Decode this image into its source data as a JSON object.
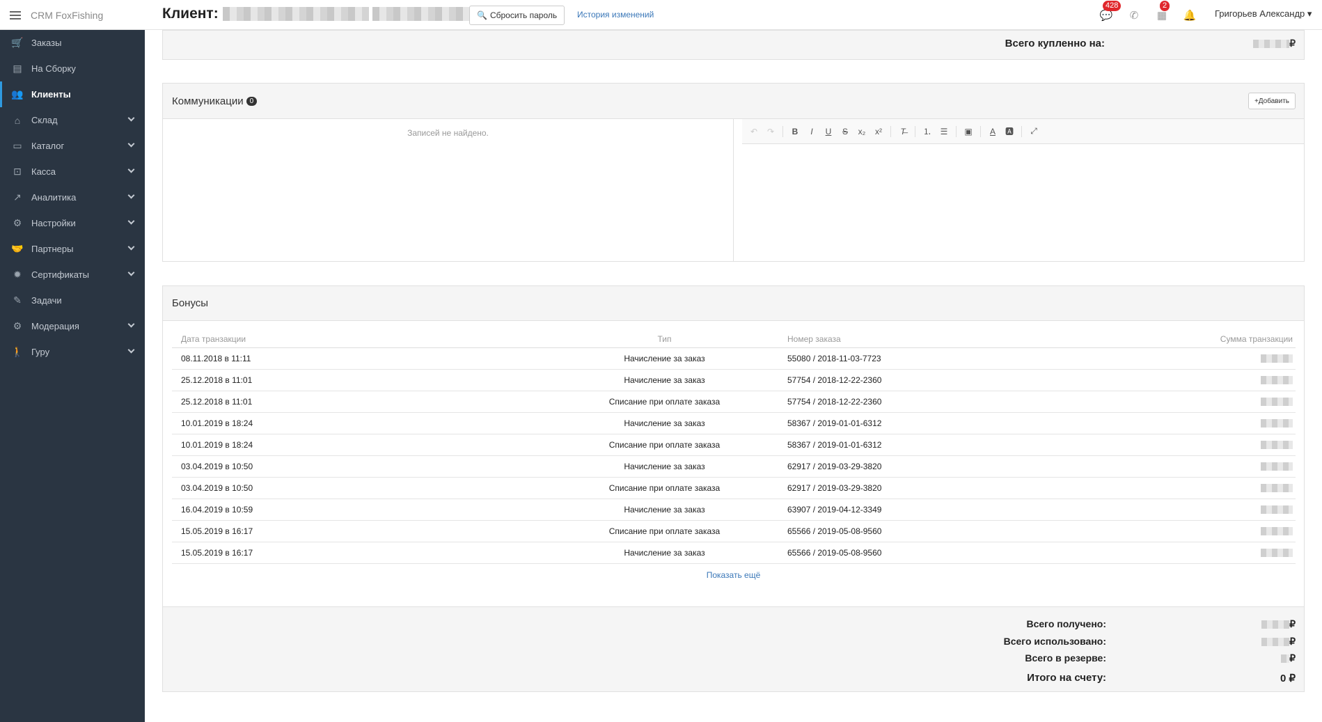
{
  "app": {
    "brand": "CRM FoxFishing"
  },
  "header": {
    "title": "Клиент:",
    "reset_password_label": "Сбросить пароль",
    "history_link": "История изменений",
    "messages_badge": "428",
    "tasks_badge": "2",
    "user_name": "Григорьев Александр"
  },
  "sidebar": {
    "items": [
      {
        "label": "Заказы",
        "icon": "cart-icon",
        "glyph": "🛒",
        "has_submenu": false,
        "active": false
      },
      {
        "label": "На Сборку",
        "icon": "box-icon",
        "glyph": "▤",
        "has_submenu": false,
        "active": false
      },
      {
        "label": "Клиенты",
        "icon": "users-icon",
        "glyph": "👥",
        "has_submenu": false,
        "active": true
      },
      {
        "label": "Склад",
        "icon": "home-icon",
        "glyph": "⌂",
        "has_submenu": true,
        "active": false
      },
      {
        "label": "Каталог",
        "icon": "catalog-icon",
        "glyph": "▭",
        "has_submenu": true,
        "active": false
      },
      {
        "label": "Касса",
        "icon": "money-icon",
        "glyph": "⊡",
        "has_submenu": true,
        "active": false
      },
      {
        "label": "Аналитика",
        "icon": "chart-icon",
        "glyph": "↗",
        "has_submenu": true,
        "active": false
      },
      {
        "label": "Настройки",
        "icon": "gears-icon",
        "glyph": "⚙",
        "has_submenu": true,
        "active": false
      },
      {
        "label": "Партнеры",
        "icon": "handshake-icon",
        "glyph": "🤝",
        "has_submenu": true,
        "active": false
      },
      {
        "label": "Сертификаты",
        "icon": "certificate-icon",
        "glyph": "✹",
        "has_submenu": true,
        "active": false
      },
      {
        "label": "Задачи",
        "icon": "tag-icon",
        "glyph": "✎",
        "has_submenu": false,
        "active": false
      },
      {
        "label": "Модерация",
        "icon": "gears-icon",
        "glyph": "⚙",
        "has_submenu": true,
        "active": false
      },
      {
        "label": "Гуру",
        "icon": "walker-icon",
        "glyph": "🚶",
        "has_submenu": true,
        "active": false
      }
    ]
  },
  "summary": {
    "total_bought_label": "Всего купленно на:",
    "currency": "₽"
  },
  "communications": {
    "title": "Коммуникации",
    "count": "0",
    "add_label": "Добавить",
    "empty_text": "Записей не найдено."
  },
  "bonuses": {
    "title": "Бонусы",
    "columns": [
      "Дата транзакции",
      "Тип",
      "Номер заказа",
      "Сумма транзакции"
    ],
    "rows": [
      {
        "date": "08.11.2018 в 11:11",
        "type": "Начисление за заказ",
        "order": "55080 / 2018-11-03-7723"
      },
      {
        "date": "25.12.2018 в 11:01",
        "type": "Начисление за заказ",
        "order": "57754 / 2018-12-22-2360"
      },
      {
        "date": "25.12.2018 в 11:01",
        "type": "Списание при оплате заказа",
        "order": "57754 / 2018-12-22-2360"
      },
      {
        "date": "10.01.2019 в 18:24",
        "type": "Начисление за заказ",
        "order": "58367 / 2019-01-01-6312"
      },
      {
        "date": "10.01.2019 в 18:24",
        "type": "Списание при оплате заказа",
        "order": "58367 / 2019-01-01-6312"
      },
      {
        "date": "03.04.2019 в 10:50",
        "type": "Начисление за заказ",
        "order": "62917 / 2019-03-29-3820"
      },
      {
        "date": "03.04.2019 в 10:50",
        "type": "Списание при оплате заказа",
        "order": "62917 / 2019-03-29-3820"
      },
      {
        "date": "16.04.2019 в 10:59",
        "type": "Начисление за заказ",
        "order": "63907 / 2019-04-12-3349"
      },
      {
        "date": "15.05.2019 в 16:17",
        "type": "Списание при оплате заказа",
        "order": "65566 / 2019-05-08-9560"
      },
      {
        "date": "15.05.2019 в 16:17",
        "type": "Начисление за заказ",
        "order": "65566 / 2019-05-08-9560"
      }
    ],
    "show_more": "Показать ещё",
    "totals": {
      "received_label": "Всего получено:",
      "used_label": "Всего использовано:",
      "reserved_label": "Всего в резерве:",
      "balance_label": "Итого на счету:",
      "balance_value": "0 ₽"
    }
  }
}
